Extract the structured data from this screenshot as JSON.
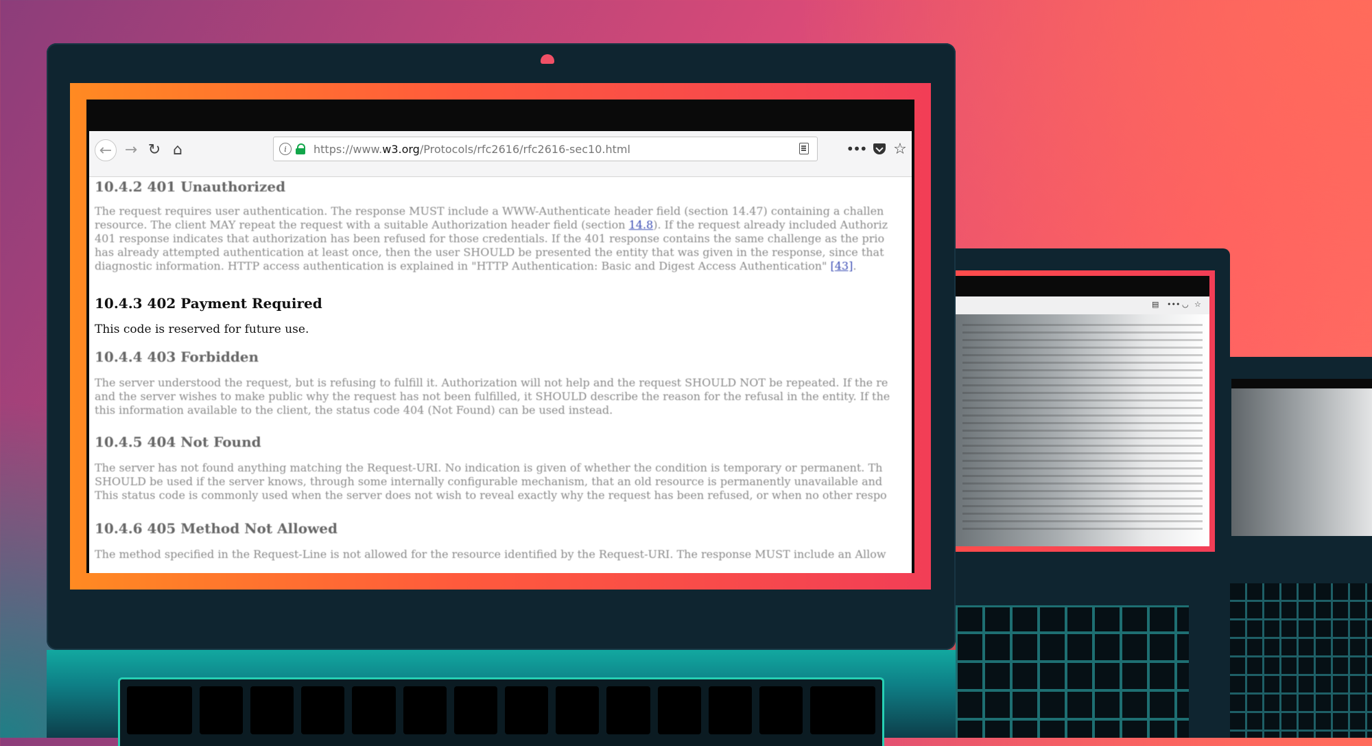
{
  "browser": {
    "url_prefix": "https://www.",
    "url_domain": "w3.org",
    "url_path": "/Protocols/rfc2616/rfc2616-sec10.html",
    "icons": {
      "back": "←",
      "forward": "→",
      "reload": "↻",
      "home": "⌂",
      "more": "•••",
      "star": "☆"
    }
  },
  "sections": [
    {
      "heading": "10.4.2 401 Unauthorized",
      "lines": [
        "The request requires user authentication. The response MUST include a WWW-Authenticate header field (section 14.47) containing a challen",
        "resource. The client MAY repeat the request with a suitable Authorization header field (section ",
        "401 response indicates that authorization has been refused for those credentials. If the 401 response contains the same challenge as the prio",
        "has already attempted authentication at least once, then the user SHOULD be presented the entity that was given in the response, since that",
        "diagnostic information. HTTP access authentication is explained in \"HTTP Authentication: Basic and Digest Access Authentication\" "
      ],
      "link_14_8": "14.8",
      "line2_tail": "). If the request already included Authoriz",
      "link_43": "[43]",
      "line5_tail": "."
    },
    {
      "heading": "10.4.3 402 Payment Required",
      "lines": [
        "This code is reserved for future use."
      ]
    },
    {
      "heading": "10.4.4 403 Forbidden",
      "lines": [
        "The server understood the request, but is refusing to fulfill it. Authorization will not help and the request SHOULD NOT be repeated. If the re",
        "and the server wishes to make public why the request has not been fulfilled, it SHOULD describe the reason for the refusal in the entity. If the",
        "this information available to the client, the status code 404 (Not Found) can be used instead."
      ]
    },
    {
      "heading": "10.4.5 404 Not Found",
      "lines": [
        "The server has not found anything matching the Request-URI. No indication is given of whether the condition is temporary or permanent. Th",
        "SHOULD be used if the server knows, through some internally configurable mechanism, that an old resource is permanently unavailable and",
        "This status code is commonly used when the server does not wish to reveal exactly why the request has been refused, or when no other respo"
      ]
    },
    {
      "heading": "10.4.6 405 Method Not Allowed",
      "lines": [
        "The method specified in the Request-Line is not allowed for the resource identified by the Request-URI. The response MUST include an Allow"
      ]
    }
  ]
}
